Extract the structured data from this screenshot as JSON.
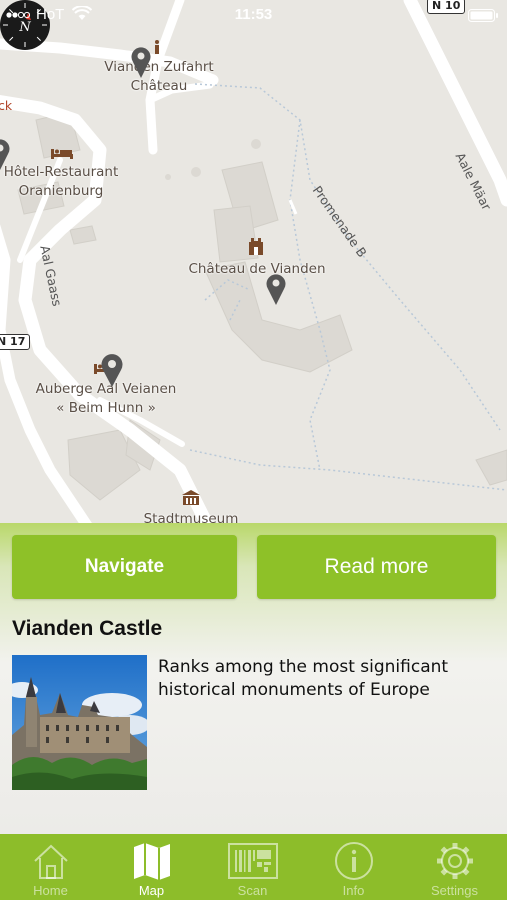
{
  "status_bar": {
    "carrier": "HoT",
    "time": "11:53"
  },
  "map": {
    "road_shields": [
      "N 10",
      "N 17"
    ],
    "street_labels": [
      "Aale Mäar",
      "Aal Gaass",
      "Promenade B"
    ],
    "partial_label": "ck",
    "pois": [
      {
        "name": "Vianden Zufahrt Château",
        "lines": [
          "Vianden Zufahrt",
          "Château"
        ],
        "icon": "info-icon"
      },
      {
        "name": "Hôtel-Restaurant Oranienburg",
        "lines": [
          "Hôtel-Restaurant",
          "Oranienburg"
        ],
        "icon": "bed-icon"
      },
      {
        "name": "Château de Vianden",
        "lines": [
          "Château de Vianden"
        ],
        "icon": "castle-icon"
      },
      {
        "name": "Auberge Aal Veianen « Beim Hunn »",
        "lines": [
          "Auberge Aal Veianen",
          "« Beim Hunn »"
        ],
        "icon": "bed-icon"
      },
      {
        "name": "Stadtmuseum",
        "lines": [
          "Stadtmuseum"
        ],
        "icon": "museum-icon"
      }
    ],
    "compass_letter": "N"
  },
  "panel": {
    "navigate_label": "Navigate",
    "read_more_label": "Read more",
    "title": "Vianden Castle",
    "description": "Ranks among the most significant historical monuments of Europe"
  },
  "tabs": [
    {
      "label": "Home",
      "icon": "home-icon",
      "active": false
    },
    {
      "label": "Map",
      "icon": "map-icon",
      "active": true
    },
    {
      "label": "Scan",
      "icon": "scan-icon",
      "active": false
    },
    {
      "label": "Info",
      "icon": "info-icon",
      "active": false
    },
    {
      "label": "Settings",
      "icon": "gear-icon",
      "active": false
    }
  ],
  "colors": {
    "accent": "#8ec128",
    "tab_bar": "#8dbd2a",
    "map_bg": "#e9e7e2"
  }
}
